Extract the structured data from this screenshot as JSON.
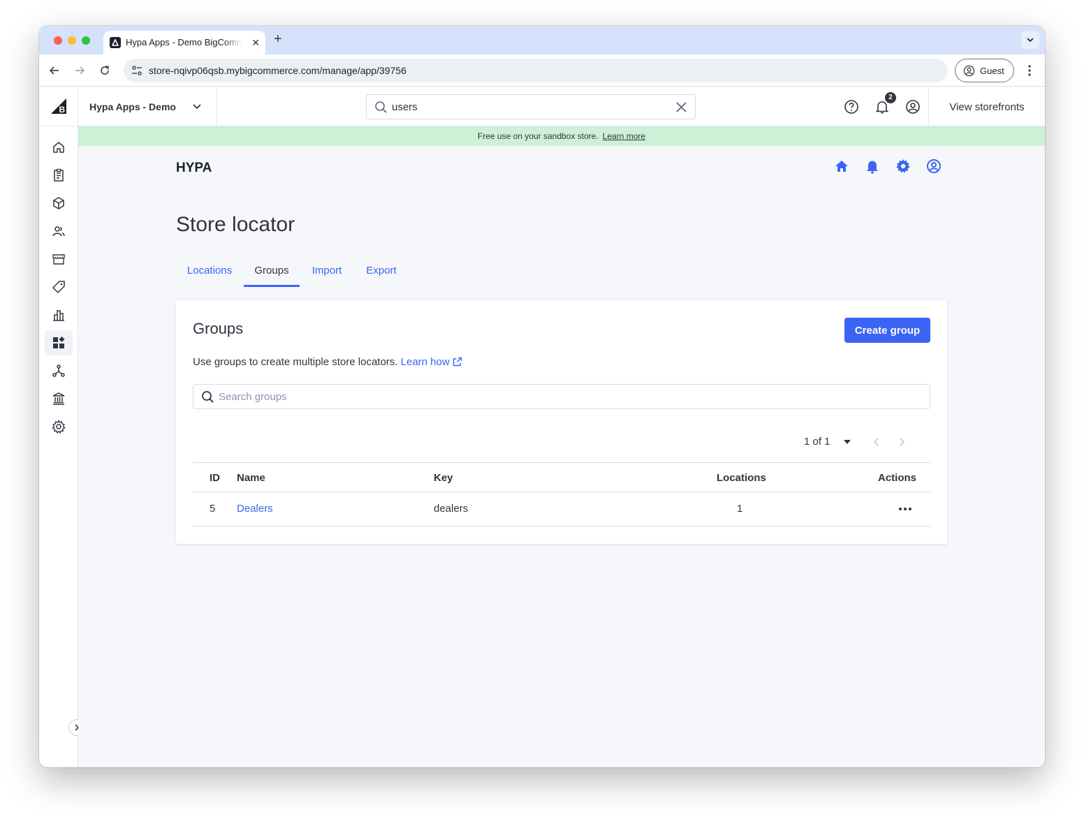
{
  "browser": {
    "tab_title": "Hypa Apps - Demo BigCommerce",
    "url": "store-nqivp06qsb.mybigcommerce.com/manage/app/39756",
    "profile_label": "Guest"
  },
  "header": {
    "store_name": "Hypa Apps - Demo",
    "search_value": "users",
    "notification_count": "2",
    "view_storefronts": "View storefronts"
  },
  "sidebar": {
    "items": [
      {
        "icon": "home-icon"
      },
      {
        "icon": "orders-icon"
      },
      {
        "icon": "products-icon"
      },
      {
        "icon": "customers-icon"
      },
      {
        "icon": "storefront-icon"
      },
      {
        "icon": "marketing-icon"
      },
      {
        "icon": "analytics-icon"
      },
      {
        "icon": "apps-icon",
        "active": true
      },
      {
        "icon": "channels-icon"
      },
      {
        "icon": "finance-icon"
      },
      {
        "icon": "settings-icon"
      }
    ]
  },
  "banner": {
    "text": "Free use on your sandbox store.",
    "link": "Learn more"
  },
  "app": {
    "logo_text": "HYPA",
    "page_title": "Store locator",
    "tabs": [
      {
        "label": "Locations",
        "active": false
      },
      {
        "label": "Groups",
        "active": true
      },
      {
        "label": "Import",
        "active": false
      },
      {
        "label": "Export",
        "active": false
      }
    ],
    "card": {
      "title": "Groups",
      "create_button": "Create group",
      "description": "Use groups to create multiple store locators.",
      "description_link": "Learn how",
      "search_placeholder": "Search groups",
      "pagination": "1 of 1",
      "columns": [
        "ID",
        "Name",
        "Key",
        "Locations",
        "Actions"
      ],
      "rows": [
        {
          "id": "5",
          "name": "Dealers",
          "key": "dealers",
          "locations": "1"
        }
      ]
    }
  },
  "colors": {
    "accent": "#3c64f4",
    "banner": "#cdf0d6",
    "text": "#313440"
  }
}
